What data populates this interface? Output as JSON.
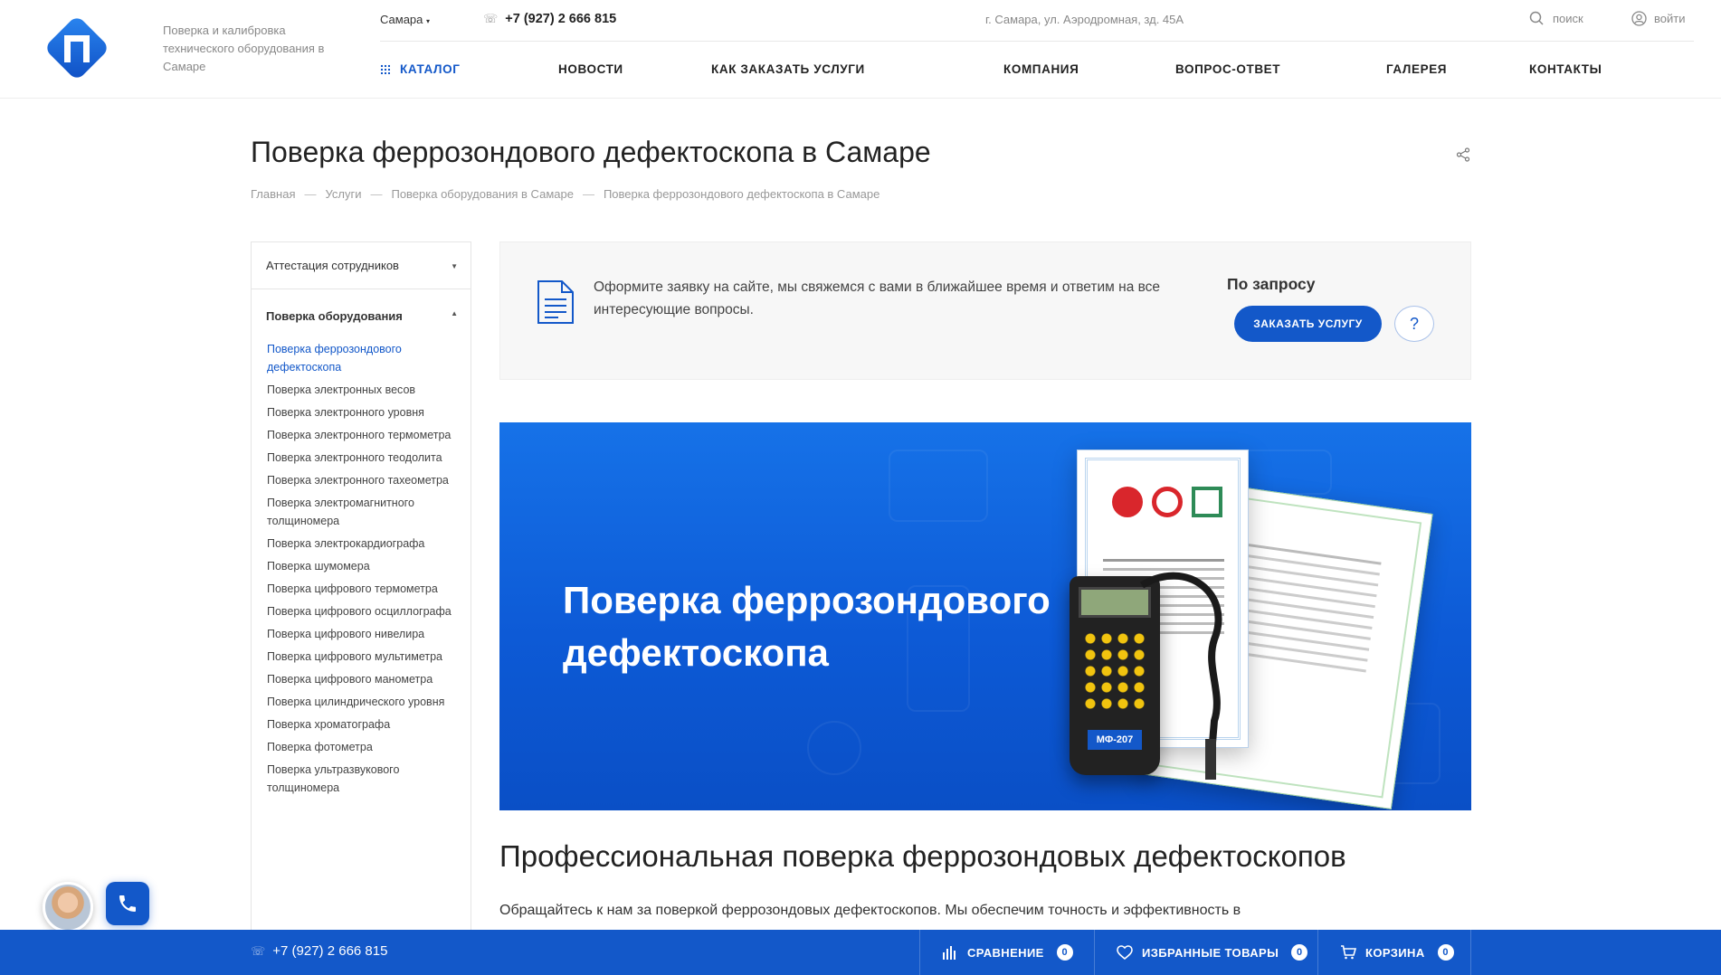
{
  "header": {
    "slogan": "Поверка и калибровка технического оборудования в Самаре",
    "city": "Самара",
    "phone": "+7 (927) 2 666 815",
    "address": "г. Самара, ул. Аэродромная, зд. 45А",
    "search_label": "поиск",
    "login_label": "войти"
  },
  "nav": {
    "items": [
      "КАТАЛОГ",
      "НОВОСТИ",
      "КАК ЗАКАЗАТЬ УСЛУГИ",
      "КОМПАНИЯ",
      "ВОПРОС-ОТВЕТ",
      "ГАЛЕРЕЯ",
      "КОНТАКТЫ"
    ]
  },
  "page": {
    "title": "Поверка феррозондового дефектоскопа в Самаре",
    "breadcrumb": [
      "Главная",
      "Услуги",
      "Поверка оборудования в Самаре",
      "Поверка феррозондового дефектоскопа в Самаре"
    ],
    "breadcrumb_sep": "—"
  },
  "sidebar": {
    "section1": "Аттестация сотрудников",
    "section2": "Поверка оборудования",
    "items": [
      "Поверка феррозондового дефектоскопа",
      "Поверка электронных весов",
      "Поверка электронного уровня",
      "Поверка электронного термометра",
      "Поверка электронного теодолита",
      "Поверка электронного тахеометра",
      "Поверка электромагнитного толщиномера",
      "Поверка электрокардиографа",
      "Поверка шумомера",
      "Поверка цифрового термометра",
      "Поверка цифрового осциллографа",
      "Поверка цифрового нивелира",
      "Поверка цифрового мультиметра",
      "Поверка цифрового манометра",
      "Поверка цилиндрического уровня",
      "Поверка хроматографа",
      "Поверка фотометра",
      "Поверка ультразвукового толщиномера"
    ]
  },
  "order": {
    "text": "Оформите заявку на сайте, мы свяжемся с вами в ближайшее время и ответим на все интересующие вопросы.",
    "price": "По запросу",
    "button": "ЗАКАЗАТЬ УСЛУГУ",
    "help": "?"
  },
  "banner": {
    "title": "Поверка феррозондового дефектоскопа",
    "device_label": "МФ-207"
  },
  "content": {
    "heading": "Профессиональная поверка феррозондовых дефектоскопов",
    "paragraph": "Обращайтесь к нам за поверкой феррозондовых дефектоскопов. Мы обеспечим точность и эффективность в"
  },
  "bottom_bar": {
    "phone": "+7 (927) 2 666 815",
    "compare_label": "СРАВНЕНИЕ",
    "compare_count": "0",
    "favorites_label": "ИЗБРАННЫЕ ТОВАРЫ",
    "favorites_count": "0",
    "cart_label": "КОРЗИНА",
    "cart_count": "0"
  },
  "colors": {
    "brand": "#1358c9",
    "banner": "#0d5ad6"
  }
}
